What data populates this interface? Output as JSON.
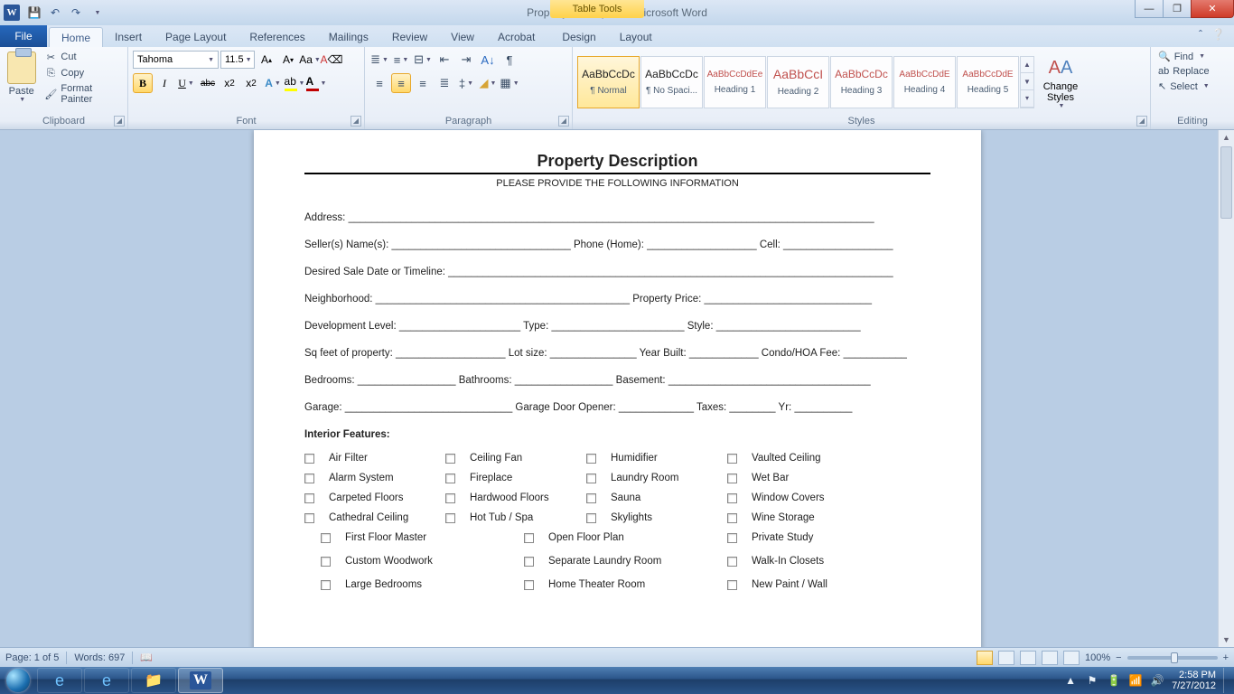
{
  "title": "Property Description  -  Microsoft Word",
  "table_tools": "Table Tools",
  "tabs": {
    "file": "File",
    "home": "Home",
    "insert": "Insert",
    "page_layout": "Page Layout",
    "references": "References",
    "mailings": "Mailings",
    "review": "Review",
    "view": "View",
    "acrobat": "Acrobat",
    "design": "Design",
    "layout": "Layout"
  },
  "clipboard": {
    "paste": "Paste",
    "cut": "Cut",
    "copy": "Copy",
    "format_painter": "Format Painter",
    "label": "Clipboard"
  },
  "font": {
    "name": "Tahoma",
    "size": "11.5",
    "label": "Font"
  },
  "paragraph": {
    "label": "Paragraph"
  },
  "styles": {
    "label": "Styles",
    "change": "Change Styles",
    "items": [
      {
        "preview": "AaBbCcDc",
        "name": "¶ Normal",
        "color": "#222222"
      },
      {
        "preview": "AaBbCcDc",
        "name": "¶ No Spaci...",
        "color": "#222222"
      },
      {
        "preview": "AaBbCcDdEe",
        "name": "Heading 1",
        "color": "#c0504d"
      },
      {
        "preview": "AaBbCcI",
        "name": "Heading 2",
        "color": "#c0504d"
      },
      {
        "preview": "AaBbCcDc",
        "name": "Heading 3",
        "color": "#c0504d"
      },
      {
        "preview": "AaBbCcDdE",
        "name": "Heading 4",
        "color": "#c0504d"
      },
      {
        "preview": "AaBbCcDdE",
        "name": "Heading 5",
        "color": "#c0504d"
      }
    ]
  },
  "editing": {
    "find": "Find",
    "replace": "Replace",
    "select": "Select",
    "label": "Editing"
  },
  "document": {
    "title": "Property Description",
    "subtitle": "PLEASE PROVIDE THE FOLLOWING INFORMATION",
    "lines": {
      "l1": "Address: ___________________________________________________________________________________________",
      "l2": "Seller(s) Name(s): _______________________________  Phone (Home): ___________________  Cell: ___________________",
      "l3": "Desired Sale Date or Timeline: _____________________________________________________________________________",
      "l4": "Neighborhood: ____________________________________________  Property Price: _____________________________",
      "l5": "Development Level: _____________________   Type: _______________________   Style: _________________________",
      "l6": "Sq feet of property: ___________________  Lot size: _______________  Year Built: ____________   Condo/HOA Fee: ___________",
      "l7": "Bedrooms: _________________  Bathrooms: _________________  Basement: ___________________________________",
      "l8": "Garage: _____________________________  Garage Door Opener: _____________  Taxes: ________  Yr: __________"
    },
    "section": "Interior Features:",
    "checks1": [
      [
        "Air Filter",
        "Ceiling Fan",
        "Humidifier",
        "Vaulted Ceiling"
      ],
      [
        "Alarm System",
        "Fireplace",
        "Laundry Room",
        "Wet Bar"
      ],
      [
        "Carpeted Floors",
        "Hardwood Floors",
        "Sauna",
        "Window Covers"
      ],
      [
        "Cathedral Ceiling",
        "Hot Tub / Spa",
        "Skylights",
        "Wine Storage"
      ]
    ],
    "checks2": [
      [
        "First Floor Master",
        "Open Floor Plan",
        "Private Study"
      ],
      [
        "Custom Woodwork",
        "Separate Laundry Room",
        "Walk-In Closets"
      ],
      [
        "Large Bedrooms",
        "Home Theater Room",
        "New Paint / Wall"
      ]
    ]
  },
  "status": {
    "page": "Page: 1 of 5",
    "words": "Words: 697",
    "zoom": "100%"
  },
  "systime": {
    "time": "2:58 PM",
    "date": "7/27/2012"
  }
}
